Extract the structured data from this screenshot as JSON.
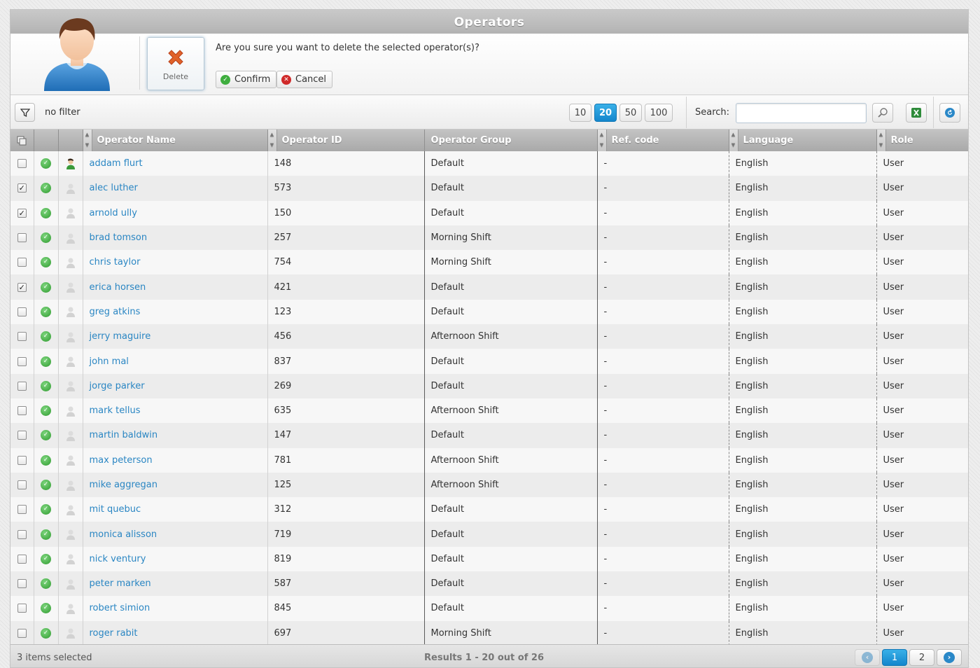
{
  "window": {
    "title": "Operators"
  },
  "confirm_dialog": {
    "delete_label": "Delete",
    "question": "Are you sure you want to delete the selected operator(s)?",
    "confirm_label": "Confirm",
    "cancel_label": "Cancel"
  },
  "toolbar": {
    "filter_text": "no filter",
    "page_sizes": [
      "10",
      "20",
      "50",
      "100"
    ],
    "active_page_size": "20",
    "search_label": "Search:",
    "search_value": "",
    "icons": {
      "filter": "filter-icon",
      "search": "magnifier-icon",
      "export": "excel-icon",
      "refresh": "refresh-icon"
    }
  },
  "columns": {
    "name": "Operator Name",
    "id": "Operator ID",
    "group": "Operator Group",
    "ref": "Ref. code",
    "language": "Language",
    "role": "Role"
  },
  "rows": [
    {
      "checked": false,
      "online": true,
      "name": "addam flurt",
      "id": "148",
      "group": "Default",
      "ref": "-",
      "language": "English",
      "role": "User"
    },
    {
      "checked": true,
      "online": false,
      "name": "alec luther",
      "id": "573",
      "group": "Default",
      "ref": "-",
      "language": "English",
      "role": "User"
    },
    {
      "checked": true,
      "online": false,
      "name": "arnold ully",
      "id": "150",
      "group": "Default",
      "ref": "-",
      "language": "English",
      "role": "User"
    },
    {
      "checked": false,
      "online": false,
      "name": "brad tomson",
      "id": "257",
      "group": "Morning Shift",
      "ref": "-",
      "language": "English",
      "role": "User"
    },
    {
      "checked": false,
      "online": false,
      "name": "chris taylor",
      "id": "754",
      "group": "Morning Shift",
      "ref": "-",
      "language": "English",
      "role": "User"
    },
    {
      "checked": true,
      "online": false,
      "name": "erica horsen",
      "id": "421",
      "group": "Default",
      "ref": "-",
      "language": "English",
      "role": "User"
    },
    {
      "checked": false,
      "online": false,
      "name": "greg atkins",
      "id": "123",
      "group": "Default",
      "ref": "-",
      "language": "English",
      "role": "User"
    },
    {
      "checked": false,
      "online": false,
      "name": "jerry maguire",
      "id": "456",
      "group": "Afternoon Shift",
      "ref": "-",
      "language": "English",
      "role": "User"
    },
    {
      "checked": false,
      "online": false,
      "name": "john mal",
      "id": "837",
      "group": "Default",
      "ref": "-",
      "language": "English",
      "role": "User"
    },
    {
      "checked": false,
      "online": false,
      "name": "jorge parker",
      "id": "269",
      "group": "Default",
      "ref": "-",
      "language": "English",
      "role": "User"
    },
    {
      "checked": false,
      "online": false,
      "name": "mark tellus",
      "id": "635",
      "group": "Afternoon Shift",
      "ref": "-",
      "language": "English",
      "role": "User"
    },
    {
      "checked": false,
      "online": false,
      "name": "martin baldwin",
      "id": "147",
      "group": "Default",
      "ref": "-",
      "language": "English",
      "role": "User"
    },
    {
      "checked": false,
      "online": false,
      "name": "max peterson",
      "id": "781",
      "group": "Afternoon Shift",
      "ref": "-",
      "language": "English",
      "role": "User"
    },
    {
      "checked": false,
      "online": false,
      "name": "mike aggregan",
      "id": "125",
      "group": "Afternoon Shift",
      "ref": "-",
      "language": "English",
      "role": "User"
    },
    {
      "checked": false,
      "online": false,
      "name": "mit quebuc",
      "id": "312",
      "group": "Default",
      "ref": "-",
      "language": "English",
      "role": "User"
    },
    {
      "checked": false,
      "online": false,
      "name": "monica alisson",
      "id": "719",
      "group": "Default",
      "ref": "-",
      "language": "English",
      "role": "User"
    },
    {
      "checked": false,
      "online": false,
      "name": "nick ventury",
      "id": "819",
      "group": "Default",
      "ref": "-",
      "language": "English",
      "role": "User"
    },
    {
      "checked": false,
      "online": false,
      "name": "peter marken",
      "id": "587",
      "group": "Default",
      "ref": "-",
      "language": "English",
      "role": "User"
    },
    {
      "checked": false,
      "online": false,
      "name": "robert simion",
      "id": "845",
      "group": "Default",
      "ref": "-",
      "language": "English",
      "role": "User"
    },
    {
      "checked": false,
      "online": false,
      "name": "roger rabit",
      "id": "697",
      "group": "Morning Shift",
      "ref": "-",
      "language": "English",
      "role": "User"
    }
  ],
  "footer": {
    "selected_text": "3 items selected",
    "results_text": "Results 1 - 20 out of 26",
    "pages": [
      "1",
      "2"
    ],
    "active_page": "1"
  },
  "colors": {
    "accent": "#1a8fd6",
    "link": "#2a86c3",
    "ok": "#3fae3f",
    "delete": "#e05a20"
  }
}
